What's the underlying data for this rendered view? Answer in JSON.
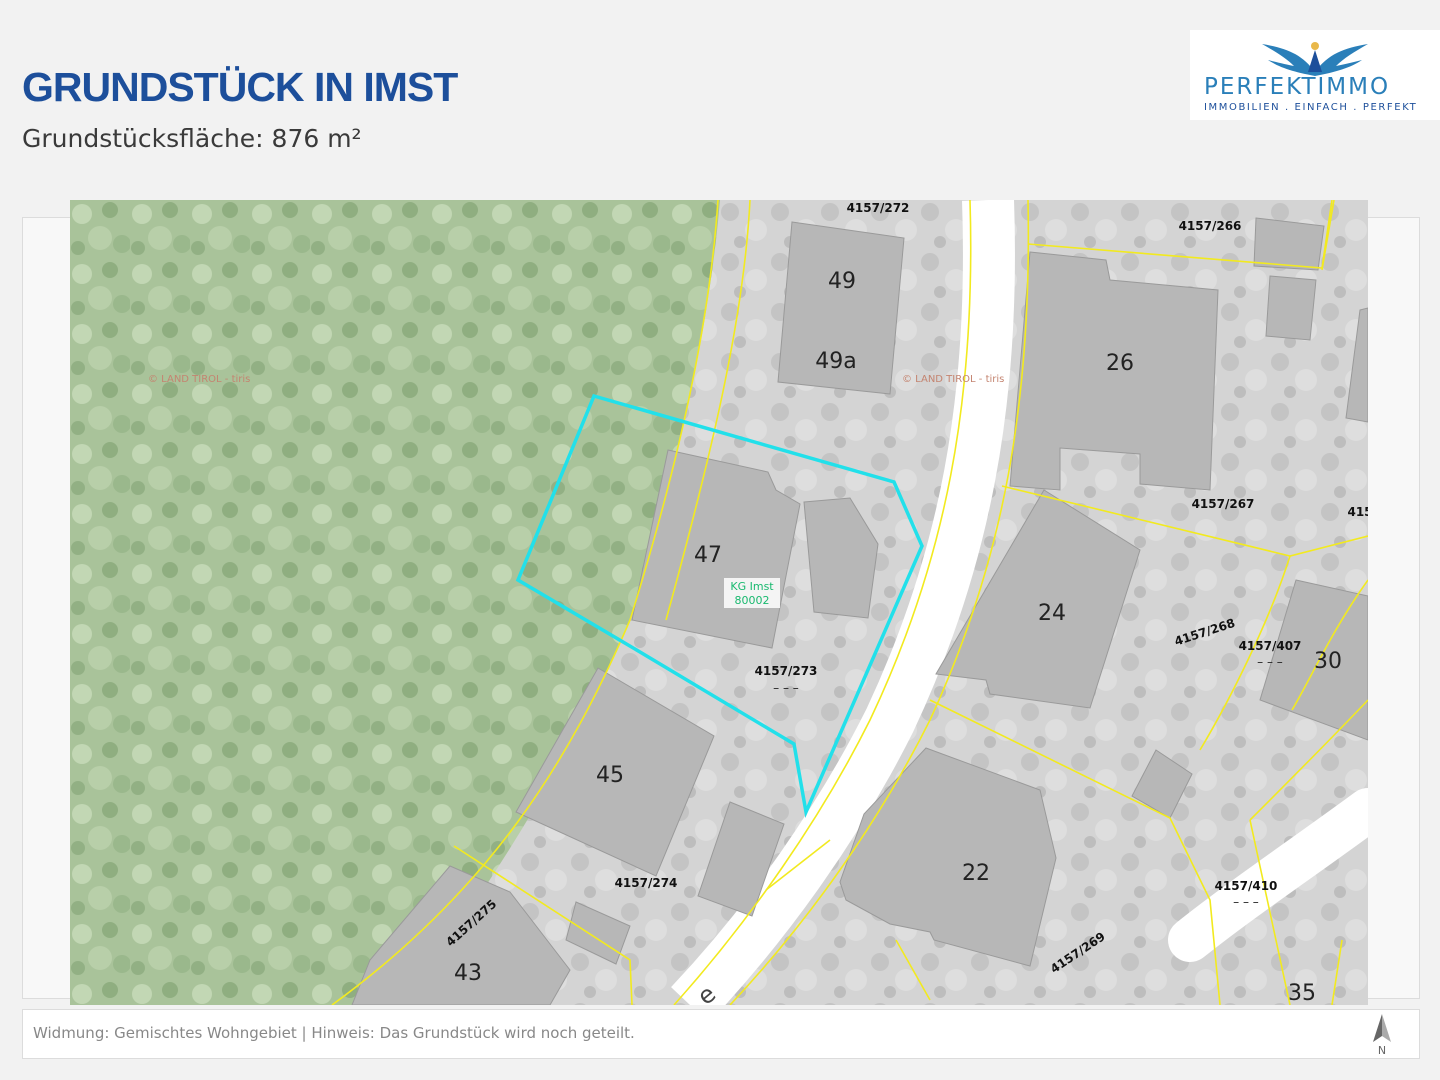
{
  "header": {
    "title_main": "GRUNDSTÜCK ",
    "title_bold": "IN IMST",
    "subtitle": "Grundstücksfläche: 876 m²"
  },
  "logo": {
    "brand": "PERFEKTIMMO",
    "tagline": "IMMOBILIEN . EINFACH . PERFEKT"
  },
  "map": {
    "colors": {
      "forest": "#a9c39a",
      "road": "#ffffff",
      "building": "#b7b7b7",
      "parcel_line": "#f2ea1f",
      "highlight": "#22e0ea",
      "kg_label": "#19b96f"
    },
    "house_numbers": [
      "49",
      "49a",
      "26",
      "47",
      "24",
      "30",
      "45",
      "22",
      "43",
      "35"
    ],
    "parcel_labels": [
      "4157/272",
      "4157/266",
      "4157/267",
      "4157/268",
      "4157/407",
      "4157/273",
      "4157/274",
      "4157/275",
      "4157/410",
      "4157/269",
      "415"
    ],
    "kg_label": {
      "line1": "KG Imst",
      "line2": "80002"
    },
    "watermark": "© LAND TIROL - tiris",
    "street_fragment": "e",
    "parcel_dash": "– – –"
  },
  "footer": {
    "note": "Widmung: Gemischtes Wohngebiet | Hinweis: Das Grundstück wird noch geteilt.",
    "north_label": "N"
  }
}
